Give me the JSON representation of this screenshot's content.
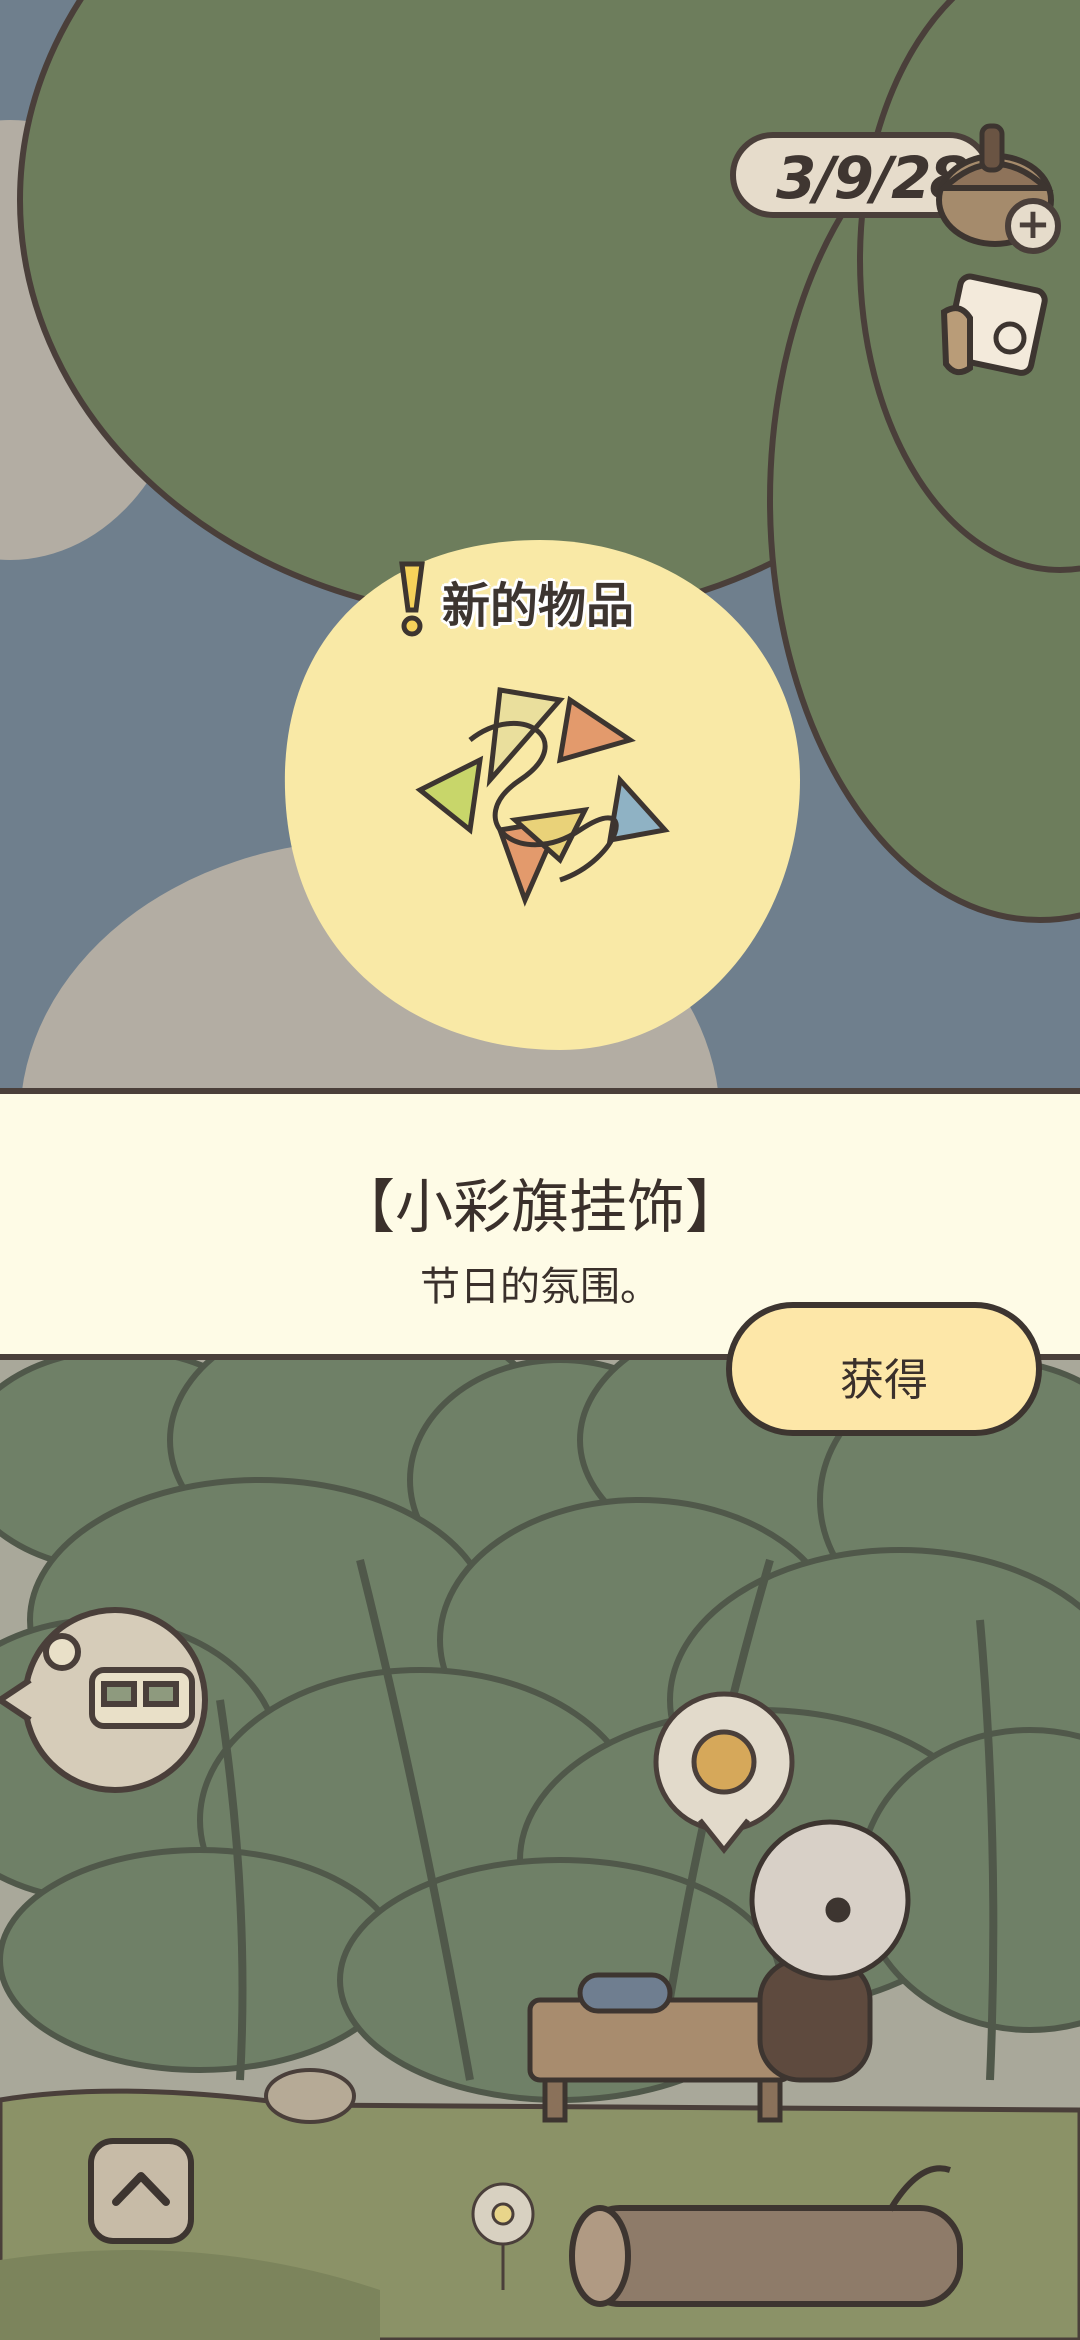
{
  "hud": {
    "clover_count": "3/9/28",
    "plus_symbol": "+",
    "icons": [
      "acorn-icon",
      "mail-icon",
      "plus-icon",
      "chevron-up-icon"
    ]
  },
  "new_item": {
    "label": "新的物品",
    "badge_symbol": "!"
  },
  "item": {
    "name": "【小彩旗挂饰】",
    "description": "节日的氛围。"
  },
  "actions": {
    "get_label": "获得"
  },
  "colors": {
    "sky": "#6f7f8d",
    "tree": "#6d7d5c",
    "banner": "#fefbe6",
    "button": "#fde7a8",
    "outline": "#4a3f3a"
  }
}
